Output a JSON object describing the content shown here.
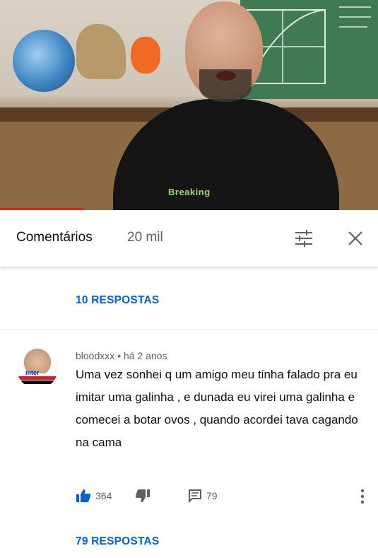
{
  "header": {
    "title": "Comentários",
    "count": "20 mil"
  },
  "video": {
    "shirt_text": "Breaking"
  },
  "previous_thread": {
    "replies_label": "10 RESPOSTAS"
  },
  "comment": {
    "author": "bloodxxx",
    "separator": "•",
    "time": "há 2 anos",
    "text": "Uma vez sonhei q um amigo meu tinha falado pra eu imitar uma galinha , e dunada eu virei uma galinha e comecei a botar ovos , quando acordei tava cagando na cama",
    "likes": "364",
    "reply_count": "79",
    "avatar_label": "inter",
    "replies_label": "79 RESPOSTAS"
  },
  "colors": {
    "link_blue": "#065fd4",
    "like_blue": "#065fd4",
    "progress_red": "#e62117"
  },
  "icons": [
    "filter-icon",
    "close-icon",
    "thumbs-up-icon",
    "thumbs-down-icon",
    "reply-icon",
    "more-vert-icon"
  ]
}
